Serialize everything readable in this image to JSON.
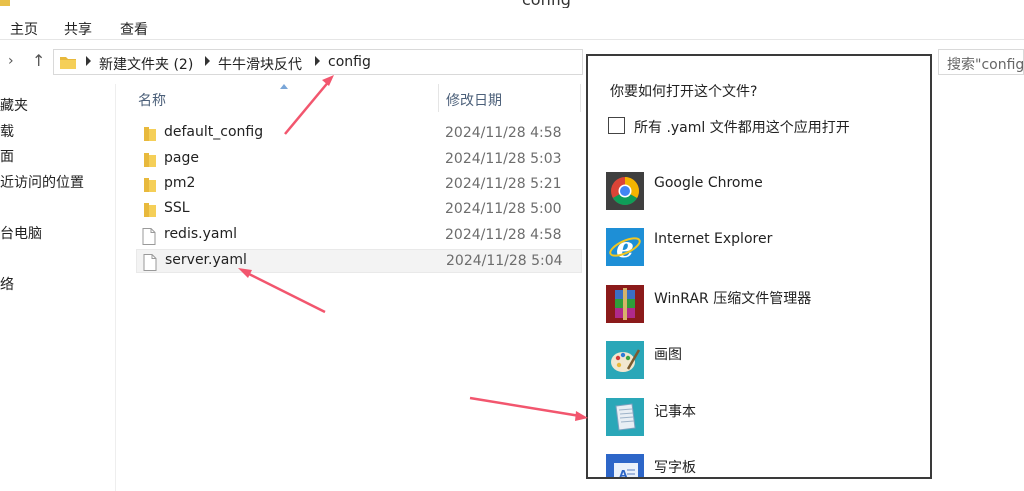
{
  "window": {
    "title": "config"
  },
  "ribbon": {
    "tabs": [
      "主页",
      "共享",
      "查看"
    ]
  },
  "address": {
    "crumbs": [
      "新建文件夹 (2)",
      "牛牛滑块反代",
      "config"
    ],
    "search_placeholder": "搜索\"config\""
  },
  "nav": {
    "items": [
      "藏夹",
      "载",
      "面",
      "近访问的位置",
      "台电脑",
      "络"
    ]
  },
  "file_list": {
    "headers": {
      "name": "名称",
      "date": "修改日期"
    },
    "rows": [
      {
        "name": "default_config",
        "date": "2024/11/28 4:58",
        "type": "folder"
      },
      {
        "name": "page",
        "date": "2024/11/28 5:03",
        "type": "folder"
      },
      {
        "name": "pm2",
        "date": "2024/11/28 5:21",
        "type": "folder"
      },
      {
        "name": "SSL",
        "date": "2024/11/28 5:00",
        "type": "folder"
      },
      {
        "name": "redis.yaml",
        "date": "2024/11/28 4:58",
        "type": "file"
      },
      {
        "name": "server.yaml",
        "date": "2024/11/28 5:04",
        "type": "file"
      }
    ]
  },
  "dialog": {
    "heading": "你要如何打开这个文件?",
    "checkbox_label": "所有 .yaml 文件都用这个应用打开",
    "checkbox_checked": false,
    "apps": [
      {
        "name": "Google Chrome",
        "icon": "chrome-icon"
      },
      {
        "name": "Internet Explorer",
        "icon": "internet-explorer-icon"
      },
      {
        "name": "WinRAR 压缩文件管理器",
        "icon": "winrar-icon"
      },
      {
        "name": "画图",
        "icon": "paint-icon"
      },
      {
        "name": "记事本",
        "icon": "notepad-icon"
      },
      {
        "name": "写字板",
        "icon": "wordpad-icon"
      }
    ]
  },
  "colors": {
    "annotation_arrow": "#f2566e",
    "folder": "#e8b93c"
  }
}
